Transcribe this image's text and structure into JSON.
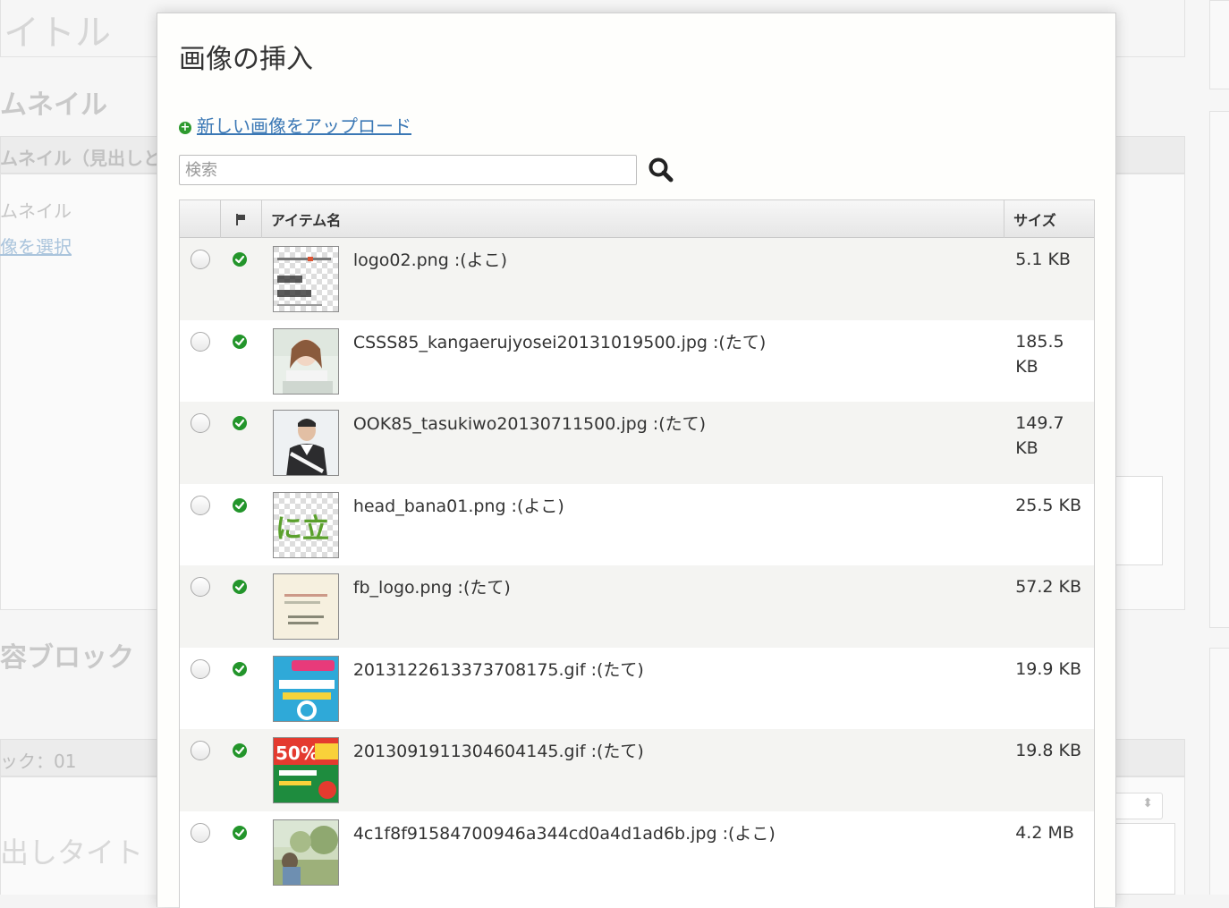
{
  "background": {
    "page_title": "イトル",
    "thumbnail_heading": "ムネイル",
    "thumbnail_bar": "ムネイル（見出しとか",
    "thumbnail_label": "ムネイル",
    "select_image_link": "像を選択",
    "block_heading": "容ブロック",
    "block_bar": "ック：01",
    "headline_placeholder": "出しタイト"
  },
  "modal": {
    "title": "画像の挿入",
    "upload_link": "新しい画像をアップロード",
    "search_placeholder": "検索"
  },
  "table": {
    "columns": [
      "",
      "",
      "アイテム名",
      "サイズ"
    ],
    "rows": [
      {
        "name": "logo02.png :(よこ)",
        "size": "5.1 KB",
        "thumb": "transparent-text"
      },
      {
        "name": "CSSS85_kangaerujyosei20131019500.jpg :(たて)",
        "size": "185.5 KB",
        "thumb": "woman-photo"
      },
      {
        "name": "OOK85_tasukiwo20130711500.jpg :(たて)",
        "size": "149.7 KB",
        "thumb": "man-photo"
      },
      {
        "name": "head_bana01.png :(よこ)",
        "size": "25.5 KB",
        "thumb": "green-text"
      },
      {
        "name": "fb_logo.png :(たて)",
        "size": "57.2 KB",
        "thumb": "beige-logo"
      },
      {
        "name": "20131226133737081​75.gif :(たて)",
        "size": "19.9 KB",
        "thumb": "blue-banner"
      },
      {
        "name": "20130919113046041​45.gif :(たて)",
        "size": "19.8 KB",
        "thumb": "sale-banner"
      },
      {
        "name": "4c1f8f91584700946a344cd0a4d1ad6b.jpg :(よこ)",
        "size": "4.2 MB",
        "thumb": "nature-photo"
      }
    ]
  },
  "colors": {
    "link": "#3b78b5",
    "status_green": "#23952b"
  }
}
